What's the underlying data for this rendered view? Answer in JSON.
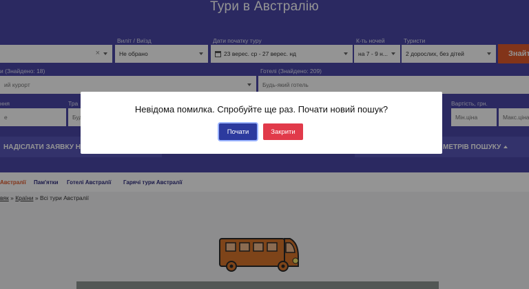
{
  "page": {
    "title": "Тури в Австралію"
  },
  "search": {
    "departure_label": "Виліт / Виїзд",
    "departure_value": "Не обрано",
    "dates_label": "Дати початку туру",
    "dates_value": "23 верес. ср - 27 верес. нд",
    "nights_label": "К-ть ночей",
    "nights_value": "на 7 - 9 н...",
    "tourists_label": "Туристи",
    "tourists_value": "2 дорослих, без дітей",
    "find_button": "Знайти",
    "resorts_label": "и (Знайдено: 18)",
    "resort_placeholder": "ий курорт",
    "hotels_label": "Готелі (Знайдено: 209)",
    "hotel_placeholder": "Будь-який готель",
    "row3_label_1": "ння",
    "row3_label_2": "Тра",
    "row3_value_1": "е",
    "row3_value_2": "Буд",
    "price_label": "Вартість, грн.",
    "price_min_placeholder": "Мін.ціна",
    "price_max_placeholder": "Макс.ціна",
    "send_request_button": "НАДІСЛАТИ ЗАЯВКУ Н",
    "params_button": "МЕТРІВ ПОШУКУ"
  },
  "subnav": {
    "items": [
      "Австралії",
      "Пам'ятки",
      "Готелі Австралії",
      "Гарячі тури Австралії"
    ]
  },
  "breadcrumbs": {
    "item1": "вяк",
    "item2": "Країни",
    "current": "Всі тури Австралії",
    "sep": "»"
  },
  "modal": {
    "message": "Невідома помилка. Спробуйте ще раз. Почати новий пошук?",
    "start_button": "Почати",
    "close_button": "Закрити"
  },
  "colors": {
    "primary": "#4a47a8",
    "accent": "#e05a2b",
    "modal_start": "#2c3a9e",
    "modal_close": "#e13a4a",
    "bus_body": "#d9762c"
  }
}
